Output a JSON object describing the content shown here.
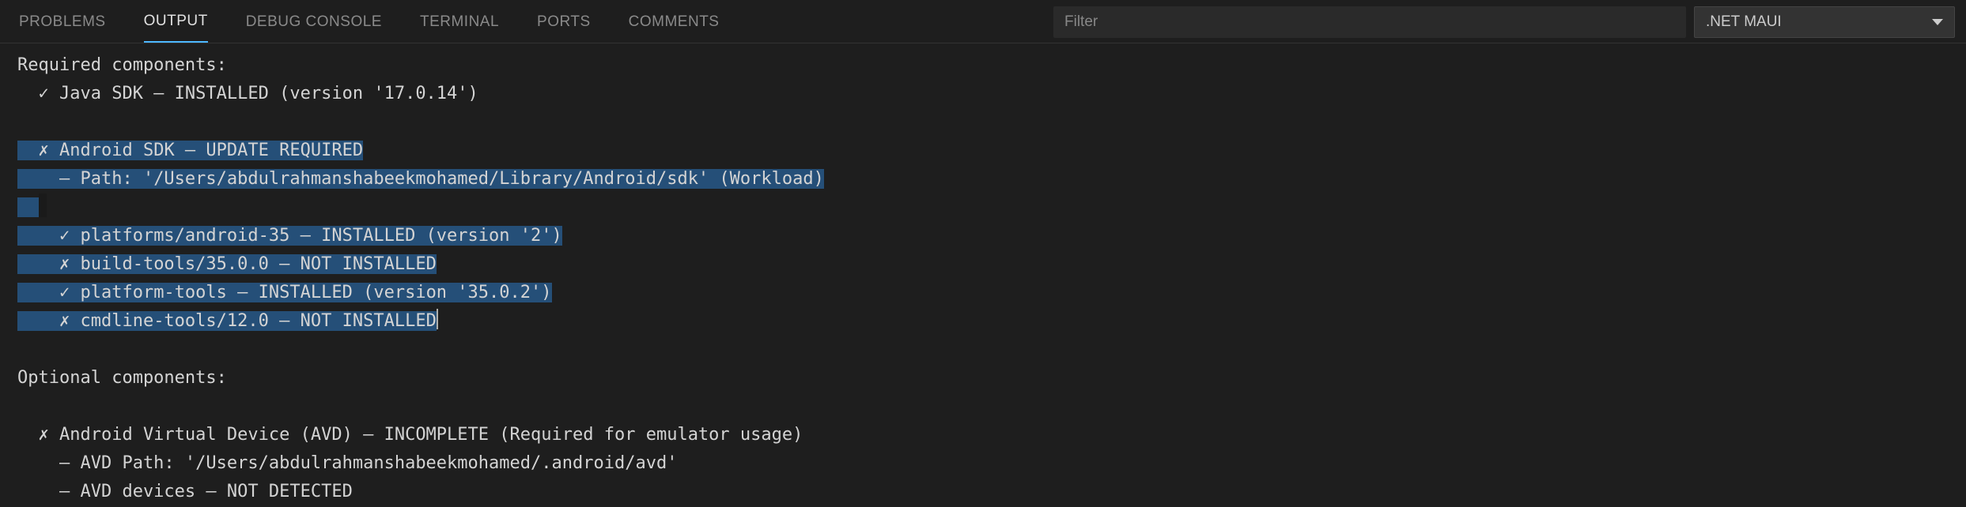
{
  "tabs": [
    {
      "label": "PROBLEMS",
      "active": false
    },
    {
      "label": "OUTPUT",
      "active": true
    },
    {
      "label": "DEBUG CONSOLE",
      "active": false
    },
    {
      "label": "TERMINAL",
      "active": false
    },
    {
      "label": "PORTS",
      "active": false
    },
    {
      "label": "COMMENTS",
      "active": false
    }
  ],
  "filter": {
    "placeholder": "Filter",
    "value": ""
  },
  "channel": {
    "selected": ".NET MAUI"
  },
  "output": {
    "lines": [
      {
        "text": "Required components:",
        "pad": "",
        "sel": false
      },
      {
        "text": "✓ Java SDK – INSTALLED (version '17.0.14')",
        "pad": "  ",
        "sel": false
      },
      {
        "text": "",
        "pad": "",
        "sel": false,
        "blank": true
      },
      {
        "text": "✗ Android SDK – UPDATE REQUIRED",
        "pad": "  ",
        "sel": true,
        "selPadStart": 0
      },
      {
        "text": "– Path: '/Users/abdulrahmanshabeekmohamed/Library/Android/sdk' (Workload)",
        "pad": "    ",
        "sel": true,
        "selPadStart": 0
      },
      {
        "text": " ",
        "pad": "",
        "sel": true,
        "blank": true,
        "blankHighlight": true
      },
      {
        "text": "✓ platforms/android-35 – INSTALLED (version '2')",
        "pad": "    ",
        "sel": true,
        "selPadStart": 0
      },
      {
        "text": "✗ build-tools/35.0.0 – NOT INSTALLED",
        "pad": "    ",
        "sel": true,
        "selPadStart": 0
      },
      {
        "text": "✓ platform-tools – INSTALLED (version '35.0.2')",
        "pad": "    ",
        "sel": true,
        "selPadStart": 0
      },
      {
        "text": "✗ cmdline-tools/12.0 – NOT INSTALLED",
        "pad": "    ",
        "sel": true,
        "caret": true,
        "selPadStart": 0
      },
      {
        "text": "",
        "pad": "",
        "sel": false,
        "blank": true
      },
      {
        "text": "Optional components:",
        "pad": "",
        "sel": false
      },
      {
        "text": "",
        "pad": "",
        "sel": false,
        "blank": true
      },
      {
        "text": "✗ Android Virtual Device (AVD) – INCOMPLETE (Required for emulator usage)",
        "pad": "  ",
        "sel": false
      },
      {
        "text": "– AVD Path: '/Users/abdulrahmanshabeekmohamed/.android/avd'",
        "pad": "    ",
        "sel": false
      },
      {
        "text": "– AVD devices – NOT DETECTED",
        "pad": "    ",
        "sel": false
      }
    ]
  }
}
